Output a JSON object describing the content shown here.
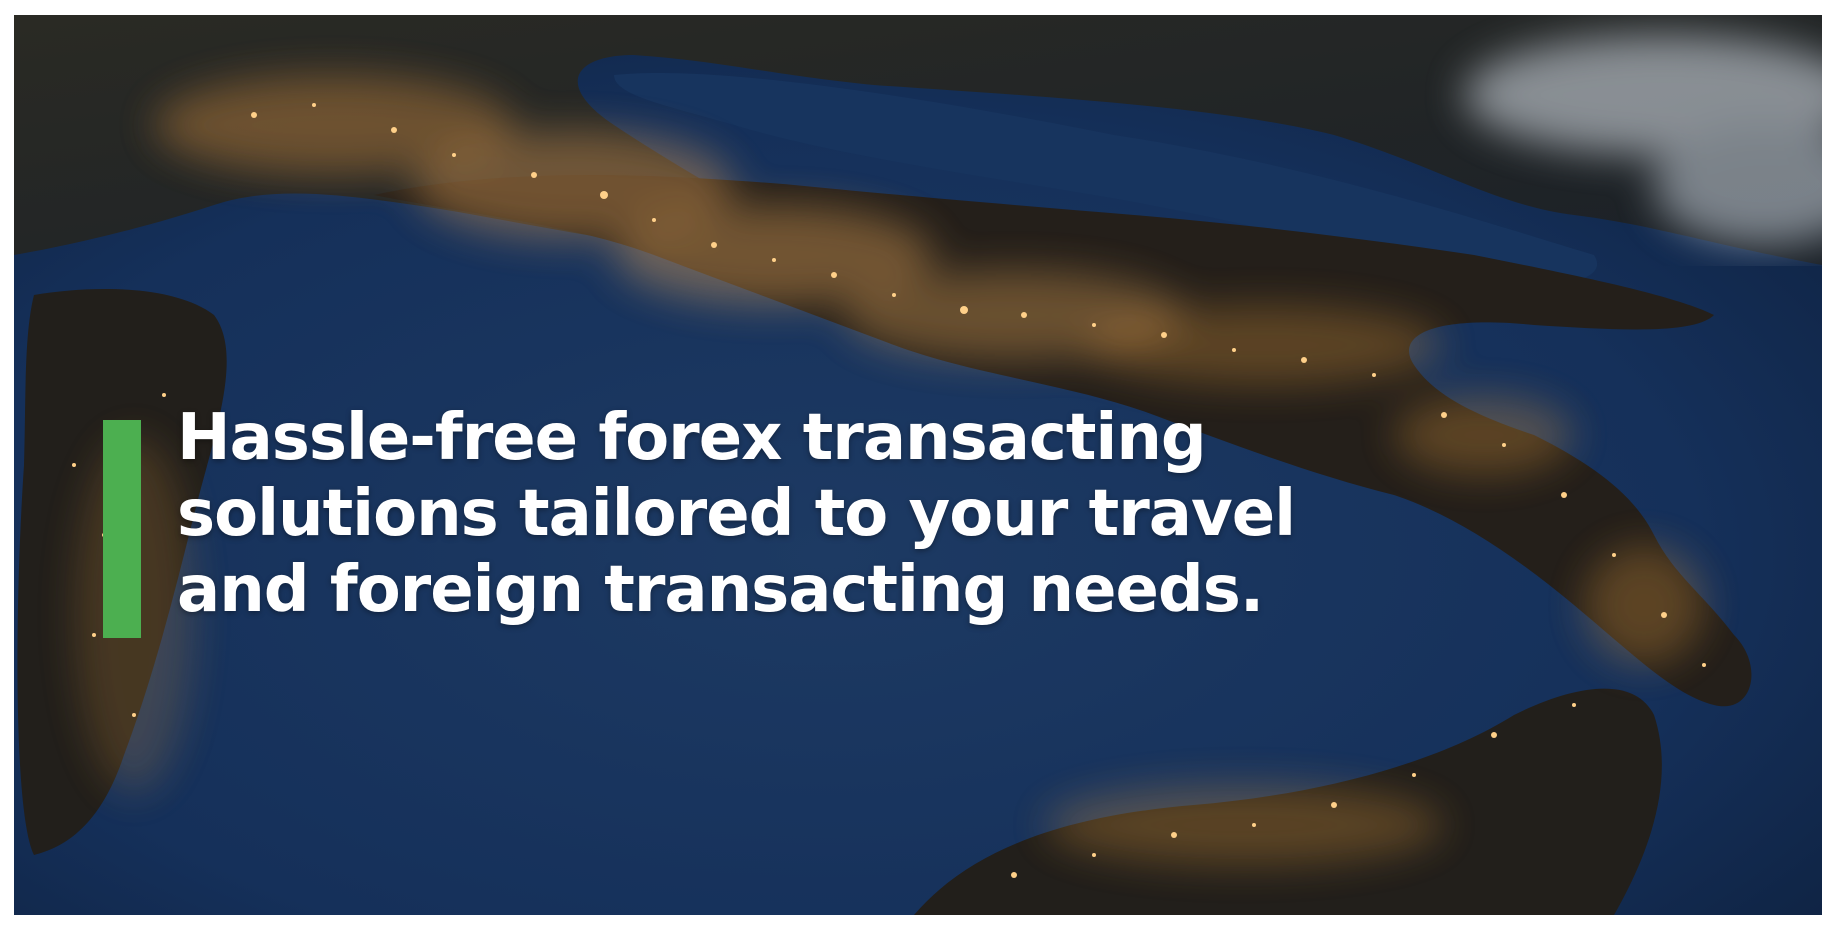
{
  "hero": {
    "headline": "Hassle-free forex transacting solutions tailored to your travel and foreign transacting needs.",
    "accent_color": "#4caf50",
    "background_image": "night satellite view of Italy and the Mediterranean",
    "text_color": "#ffffff"
  }
}
